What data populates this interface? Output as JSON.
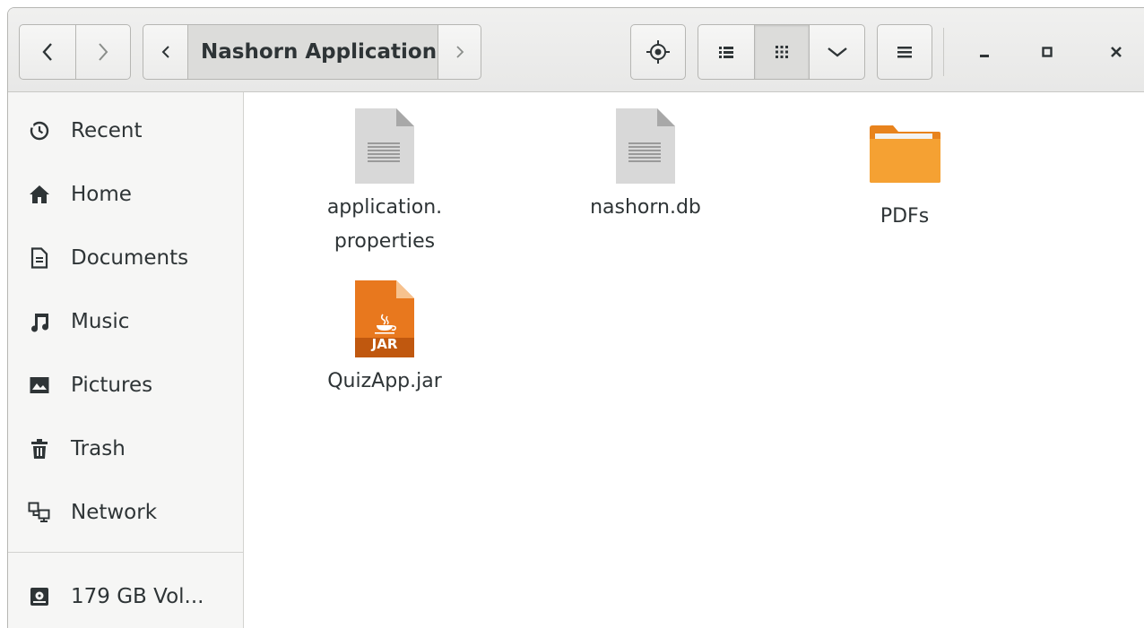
{
  "header": {
    "path_label": "Nashorn Application"
  },
  "colors": {
    "folder": "#f5a133",
    "jar": "#e8781e",
    "document": "#d8d8d8"
  },
  "sidebar": {
    "items": [
      {
        "label": "Recent",
        "icon": "clock-icon"
      },
      {
        "label": "Home",
        "icon": "home-icon"
      },
      {
        "label": "Documents",
        "icon": "document-icon"
      },
      {
        "label": "Music",
        "icon": "music-icon"
      },
      {
        "label": "Pictures",
        "icon": "picture-icon"
      },
      {
        "label": "Trash",
        "icon": "trash-icon"
      },
      {
        "label": "Network",
        "icon": "network-icon"
      },
      {
        "label": "179 GB Vol...",
        "icon": "drive-icon"
      }
    ]
  },
  "files": [
    {
      "line1": "application.",
      "line2": "properties",
      "type": "text-file"
    },
    {
      "line1": "nashorn.db",
      "line2": "",
      "type": "text-file"
    },
    {
      "line1": "PDFs",
      "line2": "",
      "type": "folder"
    },
    {
      "line1": "QuizApp.jar",
      "line2": "",
      "type": "jar-file",
      "badge": "JAR"
    }
  ]
}
